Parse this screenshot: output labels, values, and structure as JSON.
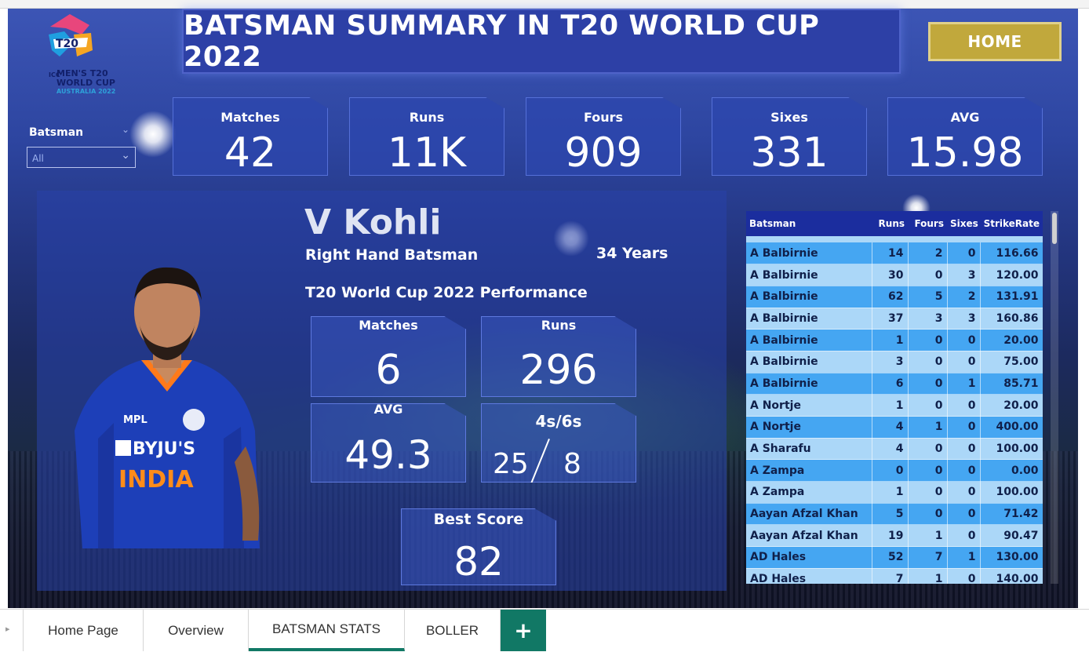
{
  "header": {
    "title": "BATSMAN SUMMARY IN T20 WORLD CUP 2022",
    "home_label": "HOME",
    "logo": {
      "t20": "T20",
      "icc": "ICC",
      "line1": "MEN'S T20",
      "line2": "WORLD CUP",
      "line3": "AUSTRALIA 2022"
    }
  },
  "slicer": {
    "label": "Batsman",
    "value": "All"
  },
  "kpis": [
    {
      "label": "Matches",
      "value": "42"
    },
    {
      "label": "Runs",
      "value": "11K"
    },
    {
      "label": "Fours",
      "value": "909"
    },
    {
      "label": "Sixes",
      "value": "331"
    },
    {
      "label": "AVG",
      "value": "15.98"
    }
  ],
  "player": {
    "name": "V Kohli",
    "type": "Right Hand Batsman",
    "age": "34 Years",
    "performance_title": "T20 World Cup 2022 Performance",
    "jersey_sponsor": "BYJU'S",
    "jersey_country": "INDIA",
    "jersey_maker": "MPL",
    "stats": {
      "matches_label": "Matches",
      "matches": "6",
      "runs_label": "Runs",
      "runs": "296",
      "avg_label": "AVG",
      "avg": "49.3",
      "boundaries_label": "4s/6s",
      "fours": "25",
      "sixes": "8",
      "best_label": "Best Score",
      "best": "82"
    }
  },
  "table": {
    "columns": [
      "Batsman",
      "Runs",
      "Fours",
      "Sixes",
      "StrikeRate"
    ],
    "rows": [
      [
        "A Balbirnie",
        "14",
        "2",
        "0",
        "116.66"
      ],
      [
        "A Balbirnie",
        "30",
        "0",
        "3",
        "120.00"
      ],
      [
        "A Balbirnie",
        "62",
        "5",
        "2",
        "131.91"
      ],
      [
        "A Balbirnie",
        "37",
        "3",
        "3",
        "160.86"
      ],
      [
        "A Balbirnie",
        "1",
        "0",
        "0",
        "20.00"
      ],
      [
        "A Balbirnie",
        "3",
        "0",
        "0",
        "75.00"
      ],
      [
        "A Balbirnie",
        "6",
        "0",
        "1",
        "85.71"
      ],
      [
        "A Nortje",
        "1",
        "0",
        "0",
        "20.00"
      ],
      [
        "A Nortje",
        "4",
        "1",
        "0",
        "400.00"
      ],
      [
        "A Sharafu",
        "4",
        "0",
        "0",
        "100.00"
      ],
      [
        "A Zampa",
        "0",
        "0",
        "0",
        "0.00"
      ],
      [
        "A Zampa",
        "1",
        "0",
        "0",
        "100.00"
      ],
      [
        "Aayan Afzal Khan",
        "5",
        "0",
        "0",
        "71.42"
      ],
      [
        "Aayan Afzal Khan",
        "19",
        "1",
        "0",
        "90.47"
      ],
      [
        "AD Hales",
        "52",
        "7",
        "1",
        "130.00"
      ],
      [
        "AD Hales",
        "7",
        "1",
        "0",
        "140.00"
      ]
    ]
  },
  "tabs": [
    {
      "label": "Home Page",
      "active": false
    },
    {
      "label": "Overview",
      "active": false
    },
    {
      "label": "BATSMAN STATS",
      "active": true
    },
    {
      "label": "BOLLER",
      "active": false
    }
  ],
  "add_tab_label": "+",
  "colors": {
    "accent": "#117865",
    "home_button": "#c1a83c",
    "title_bg": "#2d40a6",
    "table_header": "#1b2d9e",
    "row_light": "#abd7f8",
    "row_dark": "#45a6f2"
  }
}
